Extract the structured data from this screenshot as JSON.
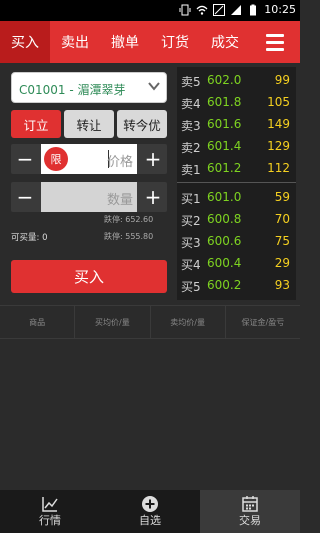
{
  "status_bar": {
    "time": "10:25"
  },
  "tabs": [
    {
      "label": "买入"
    },
    {
      "label": "卖出"
    },
    {
      "label": "撤单"
    },
    {
      "label": "订货"
    },
    {
      "label": "成交"
    }
  ],
  "form": {
    "product_select": "C01001  -  湄潭翠芽",
    "order_types": [
      "订立",
      "转让",
      "转今优"
    ],
    "price_tag": "限",
    "price_placeholder": "价格",
    "quantity_placeholder": "数量",
    "limit_up": "跌停: 652.60",
    "limit_down": "跌停: 555.80",
    "max_buy": "可买量: 0",
    "submit_label": "买入"
  },
  "order_book": {
    "asks": [
      {
        "label": "卖5",
        "price": "602.0",
        "volume": "99"
      },
      {
        "label": "卖4",
        "price": "601.8",
        "volume": "105"
      },
      {
        "label": "卖3",
        "price": "601.6",
        "volume": "149"
      },
      {
        "label": "卖2",
        "price": "601.4",
        "volume": "129"
      },
      {
        "label": "卖1",
        "price": "601.2",
        "volume": "112"
      }
    ],
    "bids": [
      {
        "label": "买1",
        "price": "601.0",
        "volume": "59"
      },
      {
        "label": "买2",
        "price": "600.8",
        "volume": "70"
      },
      {
        "label": "买3",
        "price": "600.6",
        "volume": "75"
      },
      {
        "label": "买4",
        "price": "600.4",
        "volume": "29"
      },
      {
        "label": "买5",
        "price": "600.2",
        "volume": "93"
      }
    ]
  },
  "positions_header": [
    "商品",
    "买均价/量",
    "卖均价/量",
    "保证金/盈亏"
  ],
  "bottom_nav": [
    {
      "label": "行情",
      "icon": "chart-icon"
    },
    {
      "label": "自选",
      "icon": "add-circle-icon"
    },
    {
      "label": "交易",
      "icon": "calendar-icon"
    }
  ],
  "colors": {
    "accent": "#e03131",
    "price": "#7ed321",
    "volume": "#f5d020"
  }
}
